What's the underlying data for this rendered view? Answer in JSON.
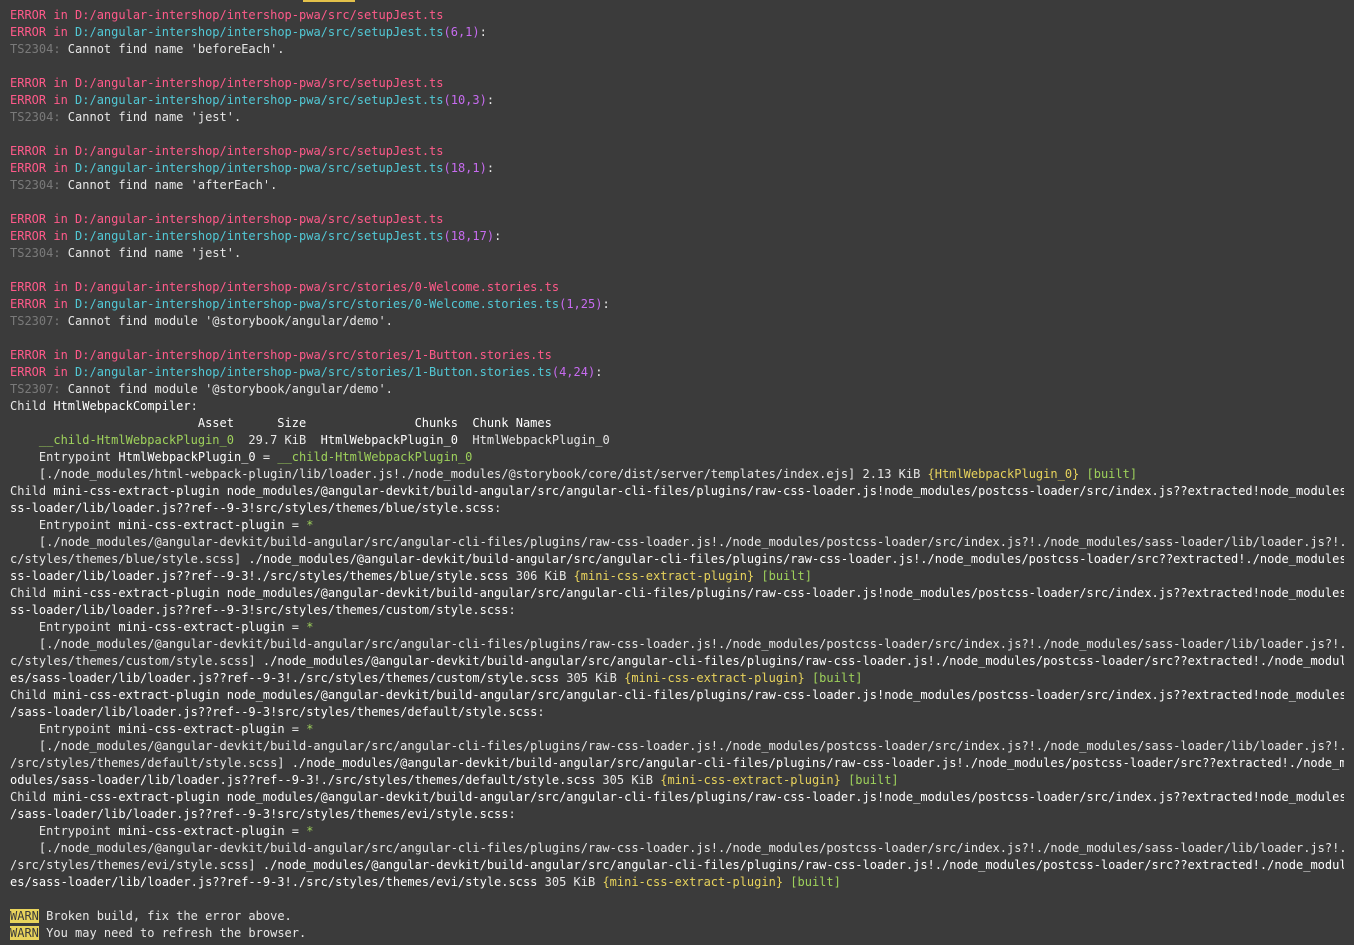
{
  "lines": [
    [
      {
        "c": "err",
        "t": "ERROR in "
      },
      {
        "c": "path-red",
        "t": "D:/angular-intershop/intershop-pwa/src/setupJest.ts"
      }
    ],
    [
      {
        "c": "err",
        "t": "ERROR in "
      },
      {
        "c": "path-cyan",
        "t": "D:/angular-intershop/intershop-pwa/src/setupJest.ts"
      },
      {
        "c": "loc",
        "t": "(6,1)"
      },
      {
        "c": "",
        "t": ":"
      }
    ],
    [
      {
        "c": "ts",
        "t": "TS2304: "
      },
      {
        "c": "",
        "t": "Cannot find name 'beforeEach'."
      }
    ],
    [],
    [
      {
        "c": "err",
        "t": "ERROR in "
      },
      {
        "c": "path-red",
        "t": "D:/angular-intershop/intershop-pwa/src/setupJest.ts"
      }
    ],
    [
      {
        "c": "err",
        "t": "ERROR in "
      },
      {
        "c": "path-cyan",
        "t": "D:/angular-intershop/intershop-pwa/src/setupJest.ts"
      },
      {
        "c": "loc",
        "t": "(10,3)"
      },
      {
        "c": "",
        "t": ":"
      }
    ],
    [
      {
        "c": "ts",
        "t": "TS2304: "
      },
      {
        "c": "",
        "t": "Cannot find name 'jest'."
      }
    ],
    [],
    [
      {
        "c": "err",
        "t": "ERROR in "
      },
      {
        "c": "path-red",
        "t": "D:/angular-intershop/intershop-pwa/src/setupJest.ts"
      }
    ],
    [
      {
        "c": "err",
        "t": "ERROR in "
      },
      {
        "c": "path-cyan",
        "t": "D:/angular-intershop/intershop-pwa/src/setupJest.ts"
      },
      {
        "c": "loc",
        "t": "(18,1)"
      },
      {
        "c": "",
        "t": ":"
      }
    ],
    [
      {
        "c": "ts",
        "t": "TS2304: "
      },
      {
        "c": "",
        "t": "Cannot find name 'afterEach'."
      }
    ],
    [],
    [
      {
        "c": "err",
        "t": "ERROR in "
      },
      {
        "c": "path-red",
        "t": "D:/angular-intershop/intershop-pwa/src/setupJest.ts"
      }
    ],
    [
      {
        "c": "err",
        "t": "ERROR in "
      },
      {
        "c": "path-cyan",
        "t": "D:/angular-intershop/intershop-pwa/src/setupJest.ts"
      },
      {
        "c": "loc",
        "t": "(18,17)"
      },
      {
        "c": "",
        "t": ":"
      }
    ],
    [
      {
        "c": "ts",
        "t": "TS2304: "
      },
      {
        "c": "",
        "t": "Cannot find name 'jest'."
      }
    ],
    [],
    [
      {
        "c": "err",
        "t": "ERROR in "
      },
      {
        "c": "path-red",
        "t": "D:/angular-intershop/intershop-pwa/src/stories/0-Welcome.stories.ts"
      }
    ],
    [
      {
        "c": "err",
        "t": "ERROR in "
      },
      {
        "c": "path-cyan",
        "t": "D:/angular-intershop/intershop-pwa/src/stories/0-Welcome.stories.ts"
      },
      {
        "c": "loc",
        "t": "(1,25)"
      },
      {
        "c": "",
        "t": ":"
      }
    ],
    [
      {
        "c": "ts",
        "t": "TS2307: "
      },
      {
        "c": "",
        "t": "Cannot find module '@storybook/angular/demo'."
      }
    ],
    [],
    [
      {
        "c": "err",
        "t": "ERROR in "
      },
      {
        "c": "path-red",
        "t": "D:/angular-intershop/intershop-pwa/src/stories/1-Button.stories.ts"
      }
    ],
    [
      {
        "c": "err",
        "t": "ERROR in "
      },
      {
        "c": "path-cyan",
        "t": "D:/angular-intershop/intershop-pwa/src/stories/1-Button.stories.ts"
      },
      {
        "c": "loc",
        "t": "(4,24)"
      },
      {
        "c": "",
        "t": ":"
      }
    ],
    [
      {
        "c": "ts",
        "t": "TS2307: "
      },
      {
        "c": "",
        "t": "Cannot find module '@storybook/angular/demo'."
      }
    ],
    [
      {
        "c": "",
        "t": "Child "
      },
      {
        "c": "bright",
        "t": "HtmlWebpackCompiler"
      },
      {
        "c": "",
        "t": ":"
      }
    ],
    [
      {
        "c": "bright",
        "t": "                          Asset      Size               Chunks  Chunk Names"
      }
    ],
    [
      {
        "c": "green",
        "t": "    __child-HtmlWebpackPlugin_0"
      },
      {
        "c": "",
        "t": "  29.7 KiB  "
      },
      {
        "c": "bright",
        "t": "HtmlWebpackPlugin_0"
      },
      {
        "c": "",
        "t": "  HtmlWebpackPlugin_0"
      }
    ],
    [
      {
        "c": "",
        "t": "    Entrypoint "
      },
      {
        "c": "bright",
        "t": "HtmlWebpackPlugin_0"
      },
      {
        "c": "",
        "t": " = "
      },
      {
        "c": "green",
        "t": "__child-HtmlWebpackPlugin_0"
      }
    ],
    [
      {
        "c": "",
        "t": "    [./node_modules/html-webpack-plugin/lib/loader.js!./node_modules/@storybook/core/dist/server/templates/index.ejs] "
      },
      {
        "c": "",
        "t": "2.13 KiB "
      },
      {
        "c": "yellow",
        "t": "{HtmlWebpackPlugin_0}"
      },
      {
        "c": "green",
        "t": " [built]"
      }
    ],
    [
      {
        "c": "",
        "t": "Child "
      },
      {
        "c": "bright",
        "t": "mini-css-extract-plugin node_modules/@angular-devkit/build-angular/src/angular-cli-files/plugins/raw-css-loader.js!node_modules/postcss-loader/src/index.js??extracted!node_modules"
      }
    ],
    [
      {
        "c": "bright",
        "t": "ss-loader/lib/loader.js??ref--9-3!src/styles/themes/blue/style.scss"
      },
      {
        "c": "",
        "t": ":"
      }
    ],
    [
      {
        "c": "",
        "t": "    Entrypoint "
      },
      {
        "c": "bright",
        "t": "mini-css-extract-plugin"
      },
      {
        "c": "",
        "t": " = "
      },
      {
        "c": "green",
        "t": "*"
      }
    ],
    [
      {
        "c": "",
        "t": "    [./node_modules/@angular-devkit/build-angular/src/angular-cli-files/plugins/raw-css-loader.js!./node_modules/postcss-loader/src/index.js?!./node_modules/sass-loader/lib/loader.js?!."
      }
    ],
    [
      {
        "c": "",
        "t": "c/styles/themes/blue/style.scss] "
      },
      {
        "c": "bright",
        "t": "./node_modules/@angular-devkit/build-angular/src/angular-cli-files/plugins/raw-css-loader.js!./node_modules/postcss-loader/src??extracted!./node_modules"
      }
    ],
    [
      {
        "c": "bright",
        "t": "ss-loader/lib/loader.js??ref--9-3!./src/styles/themes/blue/style.scss"
      },
      {
        "c": "",
        "t": " 306 KiB "
      },
      {
        "c": "yellow",
        "t": "{mini-css-extract-plugin}"
      },
      {
        "c": "green",
        "t": " [built]"
      }
    ],
    [
      {
        "c": "",
        "t": "Child "
      },
      {
        "c": "bright",
        "t": "mini-css-extract-plugin node_modules/@angular-devkit/build-angular/src/angular-cli-files/plugins/raw-css-loader.js!node_modules/postcss-loader/src/index.js??extracted!node_modules"
      }
    ],
    [
      {
        "c": "bright",
        "t": "ss-loader/lib/loader.js??ref--9-3!src/styles/themes/custom/style.scss"
      },
      {
        "c": "",
        "t": ":"
      }
    ],
    [
      {
        "c": "",
        "t": "    Entrypoint "
      },
      {
        "c": "bright",
        "t": "mini-css-extract-plugin"
      },
      {
        "c": "",
        "t": " = "
      },
      {
        "c": "green",
        "t": "*"
      }
    ],
    [
      {
        "c": "",
        "t": "    [./node_modules/@angular-devkit/build-angular/src/angular-cli-files/plugins/raw-css-loader.js!./node_modules/postcss-loader/src/index.js?!./node_modules/sass-loader/lib/loader.js?!."
      }
    ],
    [
      {
        "c": "",
        "t": "c/styles/themes/custom/style.scss] "
      },
      {
        "c": "bright",
        "t": "./node_modules/@angular-devkit/build-angular/src/angular-cli-files/plugins/raw-css-loader.js!./node_modules/postcss-loader/src??extracted!./node_modul"
      }
    ],
    [
      {
        "c": "bright",
        "t": "es/sass-loader/lib/loader.js??ref--9-3!./src/styles/themes/custom/style.scss"
      },
      {
        "c": "",
        "t": " 305 KiB "
      },
      {
        "c": "yellow",
        "t": "{mini-css-extract-plugin}"
      },
      {
        "c": "green",
        "t": " [built]"
      }
    ],
    [
      {
        "c": "",
        "t": "Child "
      },
      {
        "c": "bright",
        "t": "mini-css-extract-plugin node_modules/@angular-devkit/build-angular/src/angular-cli-files/plugins/raw-css-loader.js!node_modules/postcss-loader/src/index.js??extracted!node_modules"
      }
    ],
    [
      {
        "c": "bright",
        "t": "/sass-loader/lib/loader.js??ref--9-3!src/styles/themes/default/style.scss"
      },
      {
        "c": "",
        "t": ":"
      }
    ],
    [
      {
        "c": "",
        "t": "    Entrypoint "
      },
      {
        "c": "bright",
        "t": "mini-css-extract-plugin"
      },
      {
        "c": "",
        "t": " = "
      },
      {
        "c": "green",
        "t": "*"
      }
    ],
    [
      {
        "c": "",
        "t": "    [./node_modules/@angular-devkit/build-angular/src/angular-cli-files/plugins/raw-css-loader.js!./node_modules/postcss-loader/src/index.js?!./node_modules/sass-loader/lib/loader.js?!."
      }
    ],
    [
      {
        "c": "",
        "t": "/src/styles/themes/default/style.scss] "
      },
      {
        "c": "bright",
        "t": "./node_modules/@angular-devkit/build-angular/src/angular-cli-files/plugins/raw-css-loader.js!./node_modules/postcss-loader/src??extracted!./node_m"
      }
    ],
    [
      {
        "c": "bright",
        "t": "odules/sass-loader/lib/loader.js??ref--9-3!./src/styles/themes/default/style.scss"
      },
      {
        "c": "",
        "t": " 305 KiB "
      },
      {
        "c": "yellow",
        "t": "{mini-css-extract-plugin}"
      },
      {
        "c": "green",
        "t": " [built]"
      }
    ],
    [
      {
        "c": "",
        "t": "Child "
      },
      {
        "c": "bright",
        "t": "mini-css-extract-plugin node_modules/@angular-devkit/build-angular/src/angular-cli-files/plugins/raw-css-loader.js!node_modules/postcss-loader/src/index.js??extracted!node_modules"
      }
    ],
    [
      {
        "c": "bright",
        "t": "/sass-loader/lib/loader.js??ref--9-3!src/styles/themes/evi/style.scss"
      },
      {
        "c": "",
        "t": ":"
      }
    ],
    [
      {
        "c": "",
        "t": "    Entrypoint "
      },
      {
        "c": "bright",
        "t": "mini-css-extract-plugin"
      },
      {
        "c": "",
        "t": " = "
      },
      {
        "c": "green",
        "t": "*"
      }
    ],
    [
      {
        "c": "",
        "t": "    [./node_modules/@angular-devkit/build-angular/src/angular-cli-files/plugins/raw-css-loader.js!./node_modules/postcss-loader/src/index.js?!./node_modules/sass-loader/lib/loader.js?!."
      }
    ],
    [
      {
        "c": "",
        "t": "/src/styles/themes/evi/style.scss] "
      },
      {
        "c": "bright",
        "t": "./node_modules/@angular-devkit/build-angular/src/angular-cli-files/plugins/raw-css-loader.js!./node_modules/postcss-loader/src??extracted!./node_modul"
      }
    ],
    [
      {
        "c": "bright",
        "t": "es/sass-loader/lib/loader.js??ref--9-3!./src/styles/themes/evi/style.scss"
      },
      {
        "c": "",
        "t": " 305 KiB "
      },
      {
        "c": "yellow",
        "t": "{mini-css-extract-plugin}"
      },
      {
        "c": "green",
        "t": " [built]"
      }
    ],
    [],
    [
      {
        "c": "warn-badge",
        "t": "WARN"
      },
      {
        "c": "",
        "t": " Broken build, fix the error above."
      }
    ],
    [
      {
        "c": "warn-badge",
        "t": "WARN"
      },
      {
        "c": "",
        "t": " You may need to refresh the browser."
      }
    ]
  ],
  "colors": {
    "background": "#3b3b3b",
    "error": "#ff5a8a",
    "path": "#52c9d6",
    "location": "#c76bf0",
    "code": "#7a7a7a",
    "green": "#9ed15b",
    "yellow": "#e8d35c"
  }
}
